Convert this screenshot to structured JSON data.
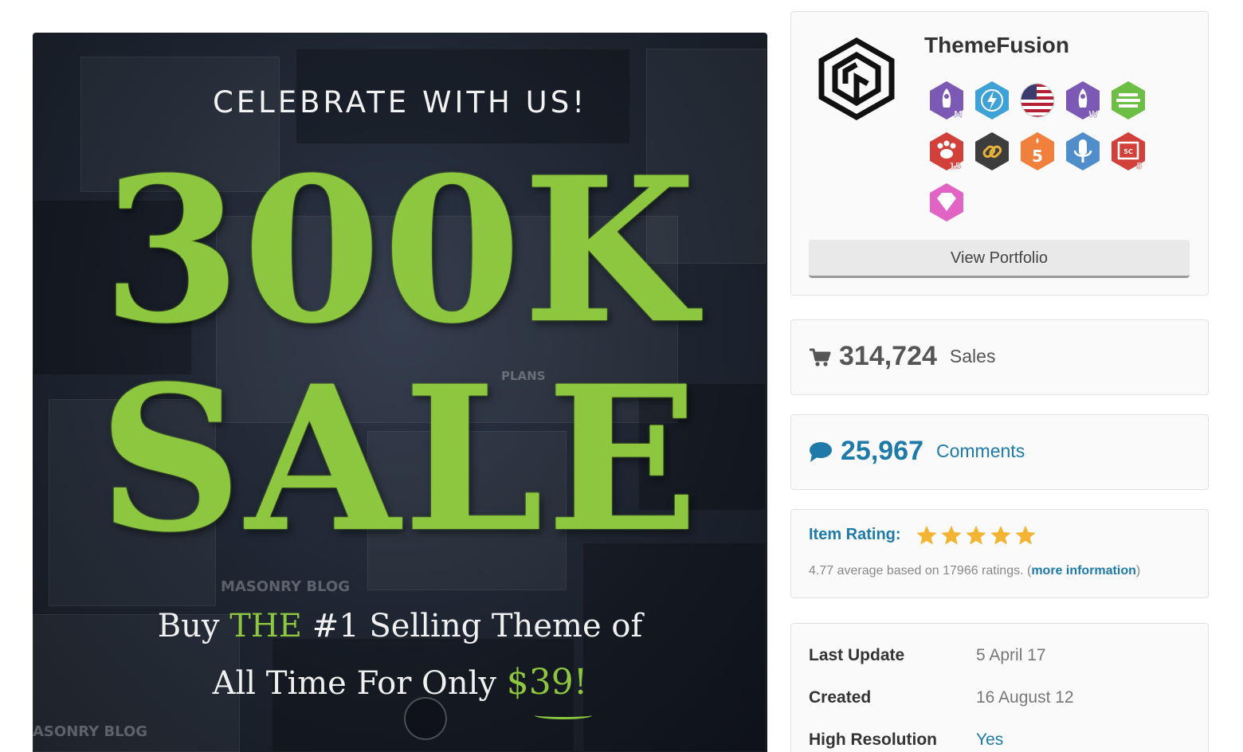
{
  "banner": {
    "top_text": "CELEBRATE WITH US!",
    "big_line_1": "300K",
    "big_line_2": "SALE",
    "line1_pre": "Buy",
    "line1_hl": "THE",
    "line1_post": "#1 Selling Theme of",
    "line2_pre": "All Time For Only",
    "line2_price": "$39!",
    "faint_text_1": "MASONRY BLOG",
    "faint_text_2": "ASONRY BLOG",
    "faint_text_3": "PLANS",
    "accent_color": "#8dc63f"
  },
  "author": {
    "name": "ThemeFusion",
    "portfolio_button": "View Portfolio",
    "badges": [
      {
        "icon": "rocket-m-badge",
        "color": "#7b59b5",
        "sub": "M"
      },
      {
        "icon": "lightning-badge",
        "color": "#3ea2d6",
        "sub": ""
      },
      {
        "icon": "us-flag-badge",
        "color": "#b22234",
        "sub": ""
      },
      {
        "icon": "rocket-w-badge",
        "color": "#7b59b5",
        "sub": "W"
      },
      {
        "icon": "stack-badge",
        "color": "#6cbe45",
        "sub": ""
      },
      {
        "icon": "paw-badge",
        "color": "#d2403a",
        "sub": "15"
      },
      {
        "icon": "link-badge",
        "color": "#3d3d3d",
        "sub": ""
      },
      {
        "icon": "five-badge",
        "color": "#f0803c",
        "sub": ""
      },
      {
        "icon": "microphone-badge",
        "color": "#4f8ecb",
        "sub": ""
      },
      {
        "icon": "chip-badge",
        "color": "#d2403a",
        "sub": "5"
      },
      {
        "icon": "diamond-badge",
        "color": "#e163c3",
        "sub": ""
      }
    ]
  },
  "sales": {
    "count": "314,724",
    "label": "Sales"
  },
  "comments": {
    "count": "25,967",
    "label": "Comments"
  },
  "rating": {
    "label": "Item Rating:",
    "stars": 5,
    "summary": "4.77 average based on 17966 ratings. (",
    "more_link": "more information",
    "close": ")",
    "star_color": "#f4b433"
  },
  "meta": [
    {
      "key": "Last Update",
      "value": "5 April 17"
    },
    {
      "key": "Created",
      "value": "16 August 12"
    },
    {
      "key": "High Resolution",
      "value": "Yes"
    }
  ]
}
